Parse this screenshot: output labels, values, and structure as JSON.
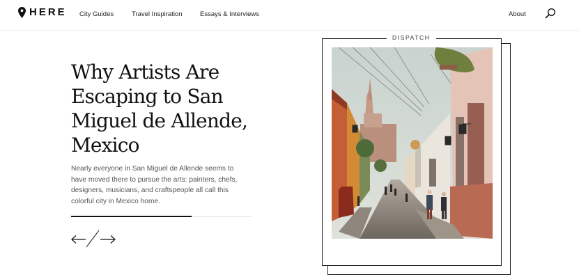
{
  "header": {
    "logo_text": "HERE",
    "nav": [
      "City Guides",
      "Travel Inspiration",
      "Essays & Interviews"
    ],
    "about": "About"
  },
  "article": {
    "headline_lines": [
      "Why Artists Are",
      "Escaping to San",
      "Miguel de Allende,",
      "Mexico"
    ],
    "summary_lines": [
      "Nearly everyone in San Miguel de Allende seems to",
      "have moved there to pursue the arts: painters, chefs,",
      "designers, musicians, and craftspeople all call this",
      "colorful city in Mexico home."
    ]
  },
  "carousel": {
    "progress": 0.67
  },
  "card": {
    "label": "DISPATCH"
  },
  "icons": {
    "logo": "map-pin-icon",
    "search": "search-icon",
    "prev": "arrow-left-icon",
    "next": "arrow-right-icon"
  },
  "colors": {
    "accent": "#111111",
    "divider": "#dddddd",
    "text_muted": "#555555"
  }
}
